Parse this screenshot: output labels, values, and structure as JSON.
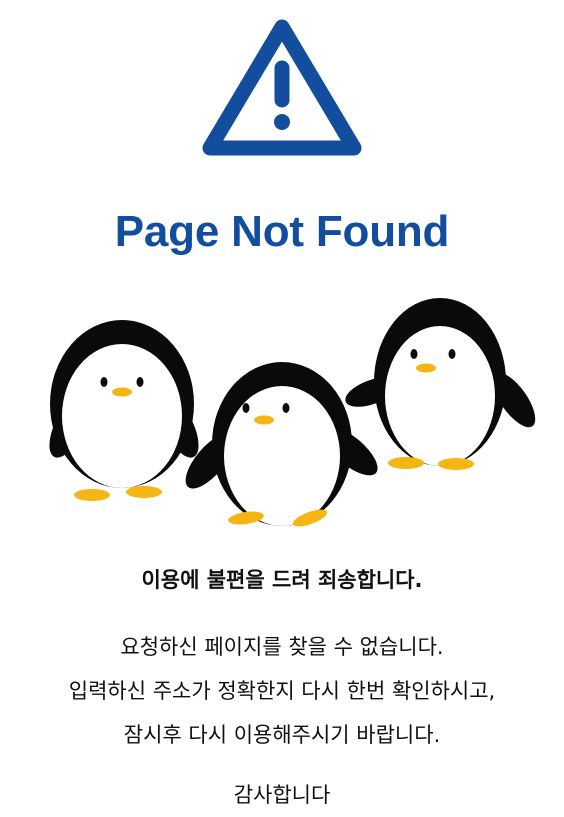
{
  "page": {
    "title": "Page Not Found",
    "apology": "이용에 불편을 드려 죄송합니다.",
    "message_lines": [
      "요청하신 페이지를 찾을 수 없습니다.",
      "입력하신 주소가 정확한지 다시 한번 확인하시고,",
      "잠시후 다시 이용해주시기 바랍니다."
    ],
    "thanks": "감사합니다"
  },
  "icons": {
    "warning": "warning-triangle-icon",
    "illustration": "penguins-illustration"
  },
  "colors": {
    "brand_blue": "#124d9e",
    "text": "#111111",
    "penguin_black": "#0a0a0a",
    "penguin_beak_feet": "#f5b512"
  }
}
